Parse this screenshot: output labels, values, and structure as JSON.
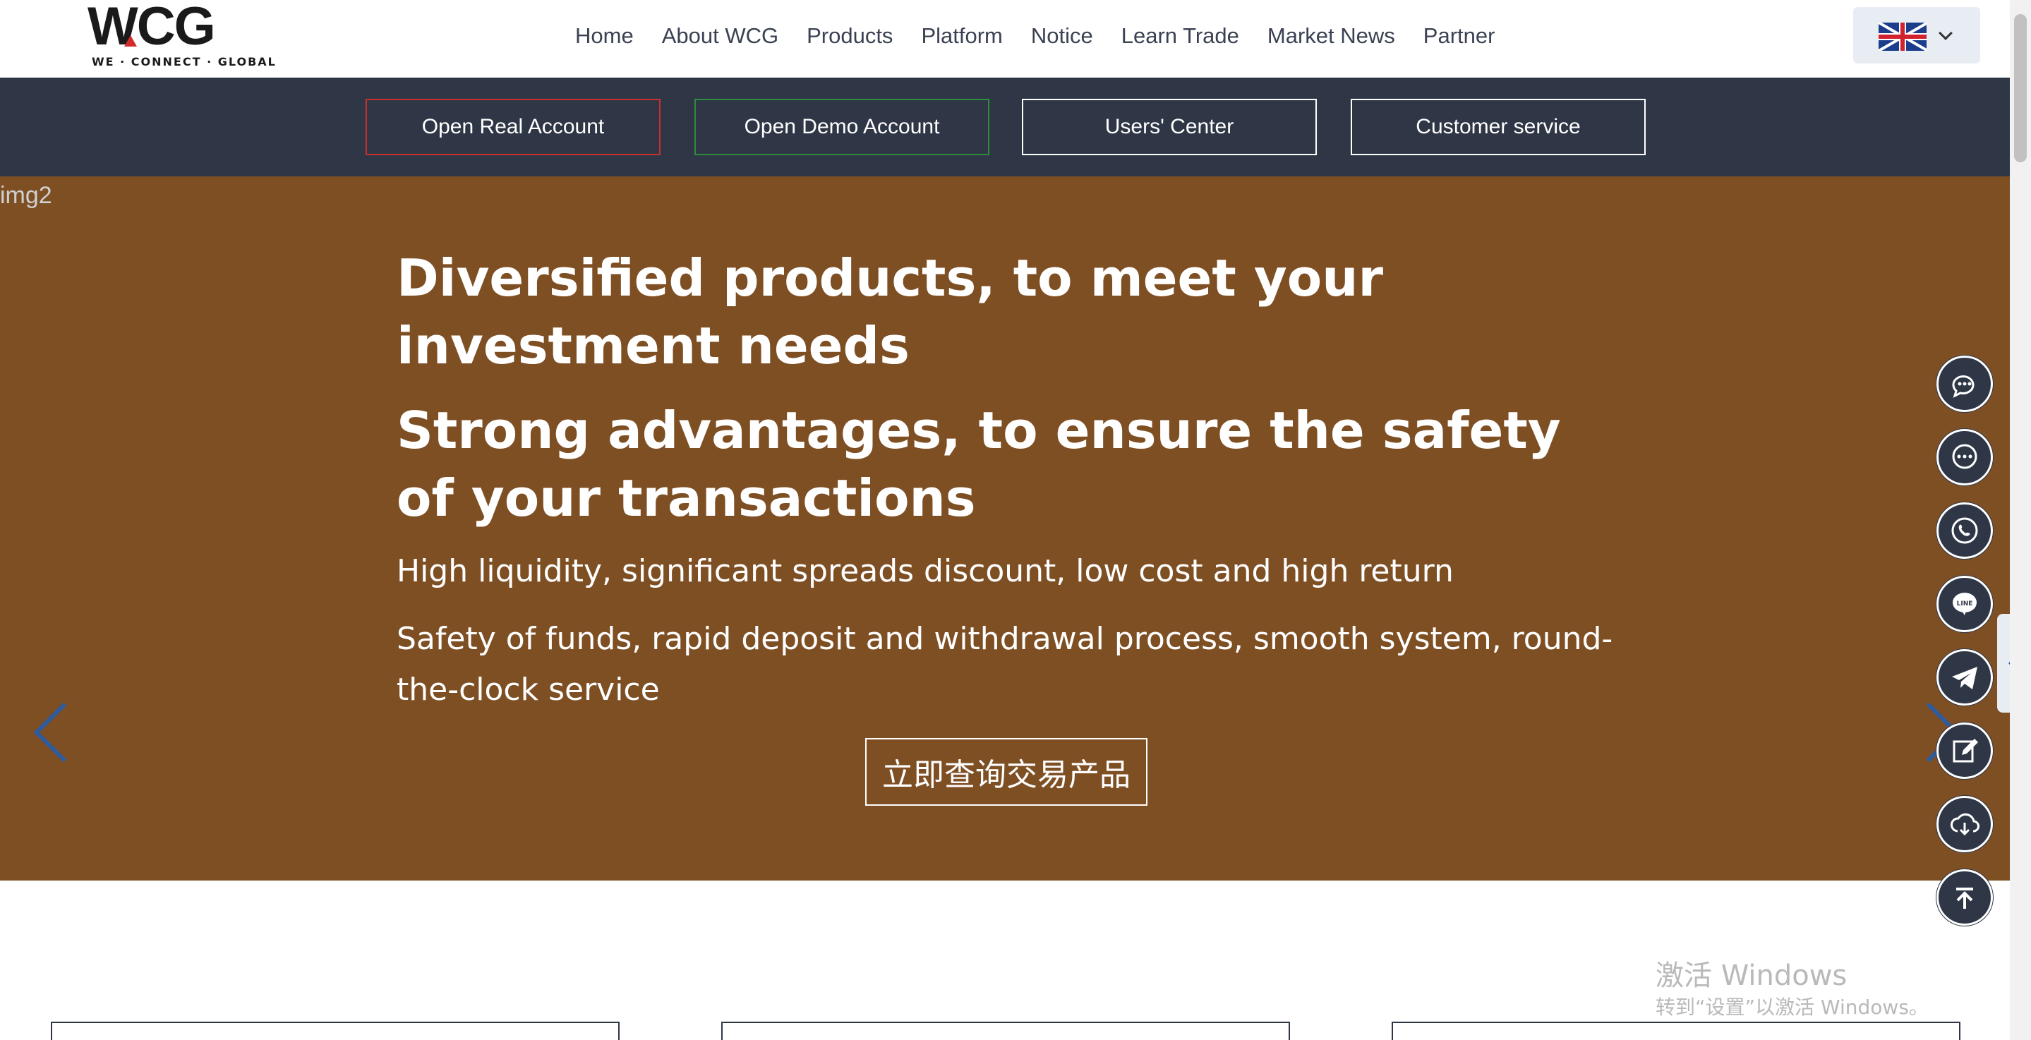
{
  "logo": {
    "mark": "WCG",
    "tagline": "WE · CONNECT · GLOBAL"
  },
  "nav": {
    "items": [
      "Home",
      "About WCG",
      "Products",
      "Platform",
      "Notice",
      "Learn Trade",
      "Market News",
      "Partner"
    ]
  },
  "language": {
    "selected_flag": "uk-flag-icon"
  },
  "actions": {
    "real": "Open Real Account",
    "demo": "Open Demo Account",
    "users": "Users' Center",
    "service": "Customer service"
  },
  "hero": {
    "image_alt": "img2",
    "title1": "Diversified products, to meet your investment needs",
    "title2": "Strong advantages, to ensure the safety of your transactions",
    "text1": "High liquidity, significant spreads discount, low cost and high return",
    "text2": "Safety of funds, rapid deposit and withdrawal process, smooth system, round-the-clock service",
    "cta": "立即查询交易产品"
  },
  "side_toolbar": [
    "chat-bubbles-icon",
    "message-icon",
    "whatsapp-icon",
    "line-icon",
    "telegram-icon",
    "edit-icon",
    "download-cloud-icon",
    "back-to-top-icon"
  ],
  "watermark": {
    "line1": "激活 Windows",
    "line2": "转到“设置”以激活 Windows。"
  },
  "colors": {
    "nav_text": "#3a4152",
    "action_bar": "#2f3747",
    "hero_bg": "#7f4f24",
    "real_border": "#c9302c",
    "demo_border": "#2e8b3a",
    "arrow": "#2d5b9e"
  }
}
